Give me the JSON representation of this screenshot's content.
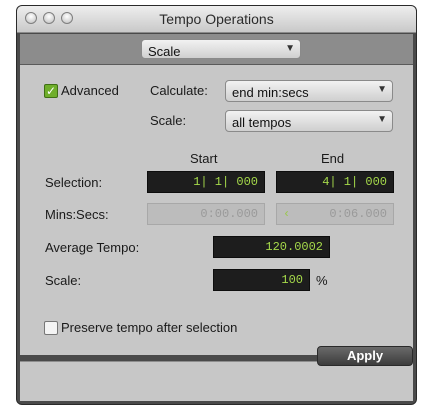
{
  "window": {
    "title": "Tempo Operations"
  },
  "operation": {
    "selected": "Scale"
  },
  "advanced": {
    "label": "Advanced",
    "checked": true
  },
  "calculate": {
    "label": "Calculate:",
    "value": "end min:secs"
  },
  "scale_mode": {
    "label": "Scale:",
    "value": "all tempos"
  },
  "columns": {
    "start": "Start",
    "end": "End"
  },
  "selection": {
    "label": "Selection:",
    "start": "1| 1| 000",
    "end": "4| 1| 000"
  },
  "mins_secs": {
    "label": "Mins:Secs:",
    "start": "0:00.000",
    "end": "0:06.000",
    "end_marker": "‹"
  },
  "average_tempo": {
    "label": "Average Tempo:",
    "value": "120.0002"
  },
  "scale": {
    "label": "Scale:",
    "value": "100",
    "unit": "%"
  },
  "preserve": {
    "label": "Preserve tempo after selection",
    "checked": false
  },
  "footer": {
    "apply_label": "Apply"
  },
  "icons": {
    "dropdown": "chevron-down-icon",
    "check": "checkmark-icon"
  },
  "colors": {
    "field_text": "#a5d94a",
    "checkbox_checked": "#6fae2b"
  }
}
